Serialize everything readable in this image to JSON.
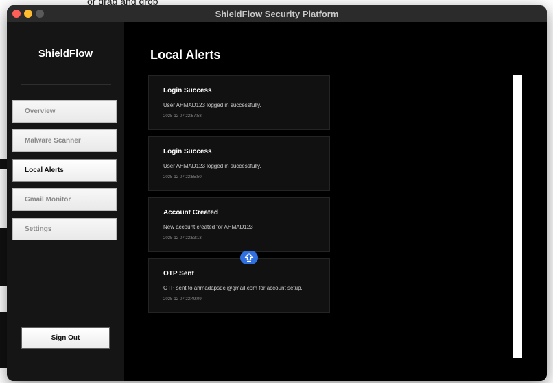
{
  "background": {
    "fragment_text": "or drag and drop"
  },
  "window": {
    "title": "ShieldFlow Security Platform"
  },
  "sidebar": {
    "brand": "ShieldFlow",
    "items": [
      {
        "label": "Overview",
        "active": false
      },
      {
        "label": "Malware Scanner",
        "active": false
      },
      {
        "label": "Local Alerts",
        "active": true
      },
      {
        "label": "Gmail Monitor",
        "active": false
      },
      {
        "label": "Settings",
        "active": false
      }
    ],
    "sign_out_label": "Sign Out"
  },
  "main": {
    "title": "Local Alerts",
    "alerts": [
      {
        "title": "Login Success",
        "message": "User AHMAD123 logged in successfully.",
        "time": "2025-12-07 22:57:58"
      },
      {
        "title": "Login Success",
        "message": "User AHMAD123 logged in successfully.",
        "time": "2025-12-07 22:55:50"
      },
      {
        "title": "Account Created",
        "message": "New account created for AHMAD123",
        "time": "2025-12-07 22:53:13"
      },
      {
        "title": "OTP Sent",
        "message": "OTP sent to ahmadapsdci@gmail.com for account setup.",
        "time": "2025-12-07 22:49:09"
      }
    ]
  },
  "colors": {
    "accent_badge": "#2f6fe0",
    "window_bg": "#000000",
    "sidebar_bg": "#151515",
    "card_bg": "#111111"
  },
  "icons": {
    "share_badge": "upload-arrow-icon"
  }
}
